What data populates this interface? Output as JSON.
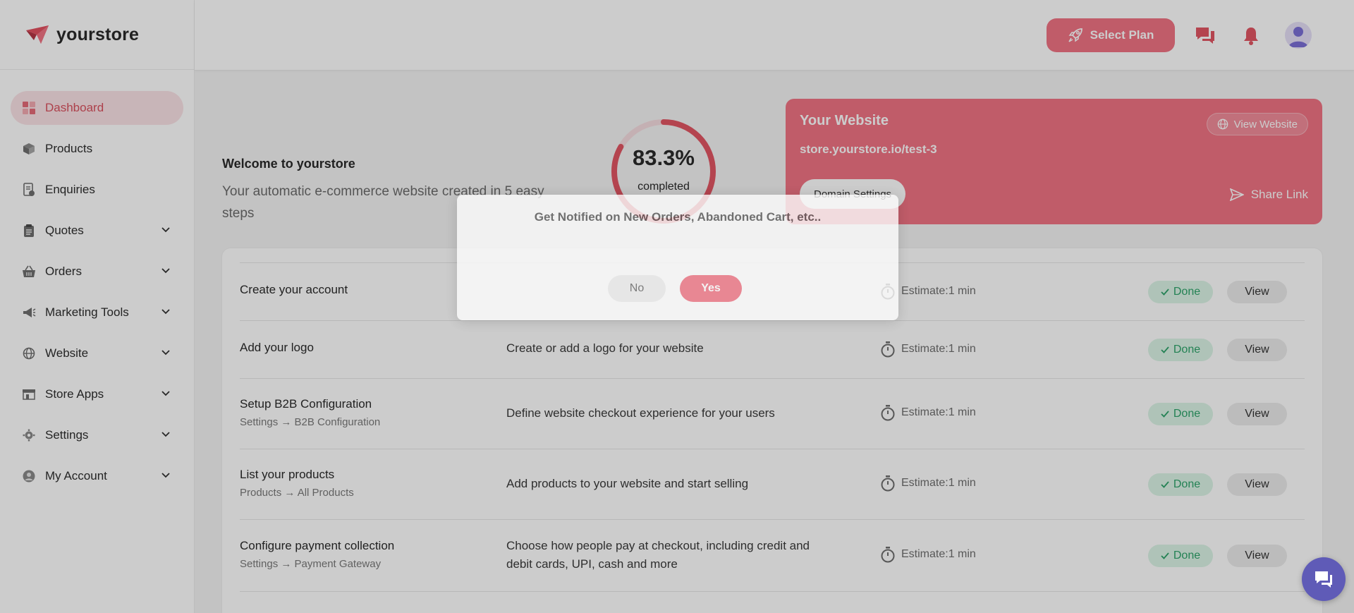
{
  "brand": {
    "name": "yourstore"
  },
  "sidebar": {
    "items": [
      {
        "label": "Dashboard",
        "icon": "dashboard-icon",
        "active": true
      },
      {
        "label": "Products",
        "icon": "box-icon"
      },
      {
        "label": "Enquiries",
        "icon": "document-icon"
      },
      {
        "label": "Quotes",
        "icon": "clipboard-icon",
        "expandable": true
      },
      {
        "label": "Orders",
        "icon": "basket-icon",
        "expandable": true
      },
      {
        "label": "Marketing Tools",
        "icon": "megaphone-icon",
        "expandable": true
      },
      {
        "label": "Website",
        "icon": "globe-icon",
        "expandable": true
      },
      {
        "label": "Store Apps",
        "icon": "store-icon",
        "expandable": true
      },
      {
        "label": "Settings",
        "icon": "gear-icon",
        "expandable": true
      },
      {
        "label": "My Account",
        "icon": "user-icon",
        "expandable": true
      }
    ]
  },
  "header": {
    "select_plan": "Select Plan",
    "icons": [
      "chat-icon",
      "bell-icon",
      "avatar-icon"
    ]
  },
  "welcome": {
    "title": "Welcome to yourstore",
    "subtitle": "Your automatic e-commerce website created in 5 easy steps"
  },
  "progress": {
    "percent_text": "83.3%",
    "label": "completed",
    "value": 0.833
  },
  "website_card": {
    "title": "Your Website",
    "url": "store.yourstore.io/test-3",
    "view_website": "View Website",
    "domain_settings": "Domain Settings",
    "share_link": "Share Link"
  },
  "steps": [
    {
      "title": "Create your account",
      "path": "",
      "desc": "",
      "estimate": "Estimate:1 min",
      "status": "Done",
      "action": "View"
    },
    {
      "title": "Add your logo",
      "path": "",
      "desc": "Create or add a logo for your website",
      "estimate": "Estimate:1 min",
      "status": "Done",
      "action": "View"
    },
    {
      "title": "Setup B2B Configuration",
      "path": "Settings → B2B Configuration",
      "desc": "Define website checkout experience for your users",
      "estimate": "Estimate:1 min",
      "status": "Done",
      "action": "View"
    },
    {
      "title": "List your products",
      "path": "Products → All Products",
      "desc": "Add products to your website and start selling",
      "estimate": "Estimate:1 min",
      "status": "Done",
      "action": "View"
    },
    {
      "title": "Configure payment collection",
      "path": "Settings → Payment Gateway",
      "desc": "Choose how people pay at checkout, including credit and debit cards, UPI, cash and more",
      "estimate": "Estimate:1 min",
      "status": "Done",
      "action": "View"
    }
  ],
  "notify": {
    "text": "Get Notified on New Orders, Abandoned Cart, etc..",
    "no": "No",
    "yes": "Yes"
  },
  "colors": {
    "accent": "#f07484",
    "accent_text": "#d9505e",
    "done_bg": "#dbf4e6",
    "done_text": "#2da36a",
    "chat_fab": "#5f5bb7"
  }
}
